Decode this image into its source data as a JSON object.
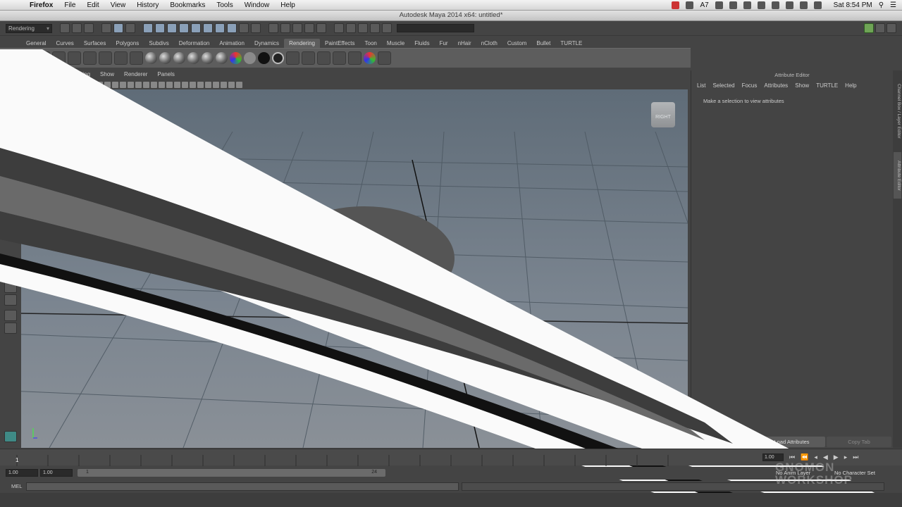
{
  "menubar": {
    "app_name": "Firefox",
    "items": [
      "File",
      "Edit",
      "View",
      "History",
      "Bookmarks",
      "Tools",
      "Window",
      "Help"
    ],
    "battery_level": "7",
    "clock": "Sat 8:54 PM"
  },
  "window": {
    "title": "Autodesk Maya 2014 x64: untitled*"
  },
  "status_line": {
    "mode": "Rendering"
  },
  "shelf": {
    "tabs": [
      "General",
      "Curves",
      "Surfaces",
      "Polygons",
      "Subdivs",
      "Deformation",
      "Animation",
      "Dynamics",
      "Rendering",
      "PaintEffects",
      "Toon",
      "Muscle",
      "Fluids",
      "Fur",
      "nHair",
      "nCloth",
      "Custom",
      "Bullet",
      "TURTLE"
    ],
    "active_tab": "Rendering"
  },
  "panel": {
    "menus": [
      "Lighting",
      "Show",
      "Renderer",
      "Panels"
    ],
    "view_cube_label": "RIGHT"
  },
  "attribute_editor": {
    "title": "Attribute Editor",
    "menus": [
      "List",
      "Selected",
      "Focus",
      "Attributes",
      "Show",
      "TURTLE",
      "Help"
    ],
    "message": "Make a selection to view attributes",
    "load_button": "Load Attributes",
    "copy_tab_button": "Copy Tab"
  },
  "side_tabs": [
    "Channel Box / Layer Editor",
    "Attribute Editor"
  ],
  "timeline": {
    "current_frame": "1",
    "current_time": "1.00",
    "range_start": "1.00",
    "playback_start": "1.00",
    "range_left_value": "1",
    "range_right_value": "24",
    "anim_layer": "No Anim Layer",
    "character_set": "No Character Set"
  },
  "command_line": {
    "label": "MEL"
  },
  "watermark": {
    "line1": "GNOMON",
    "line2": "WORKSHOP"
  },
  "colors": {
    "viewport_top": "#5f6c78",
    "ui_bg": "#444444",
    "shelf_active": "#5d5d5d"
  }
}
